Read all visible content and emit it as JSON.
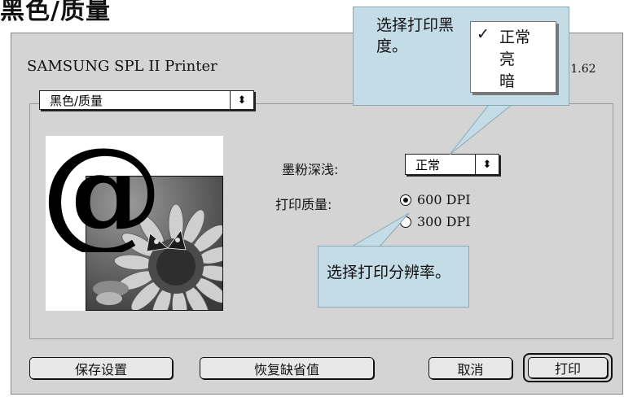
{
  "page": {
    "heading": "黑色/质量"
  },
  "dialog": {
    "title": "SAMSUNG SPL II Printer",
    "version": "v 1.62",
    "tab_popup": "黑色/质量",
    "toner": {
      "label": "墨粉深浅:",
      "value": "正常"
    },
    "quality": {
      "label": "打印质量:",
      "options": [
        {
          "label": "600 DPI",
          "selected": true
        },
        {
          "label": "300 DPI",
          "selected": false
        }
      ]
    },
    "buttons": {
      "save": "保存设置",
      "restore": "恢复缺省值",
      "cancel": "取消",
      "print": "打印"
    }
  },
  "callouts": {
    "toner_tip": "选择打印黑度。",
    "resolution_tip": "选择打印分辨率。"
  },
  "toner_menu": {
    "items": [
      {
        "label": "正常",
        "checked": true,
        "check": "✓"
      },
      {
        "label": "亮",
        "checked": false,
        "check": ""
      },
      {
        "label": "暗",
        "checked": false,
        "check": ""
      }
    ]
  },
  "icons": {
    "popup_arrows": "⬍",
    "check": "check-icon",
    "preview_symbol": "@"
  },
  "colors": {
    "dialog_bg": "#d4d4d4",
    "callout_bg": "#c4dce6"
  }
}
